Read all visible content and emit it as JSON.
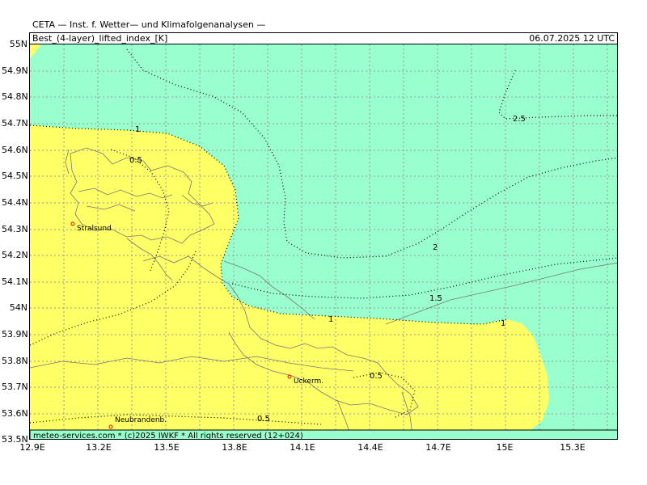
{
  "header": {
    "institute": "CETA — Inst. f. Wetter— und Klimafolgenanalysen —",
    "parameter": "Best_(4-layer)_lifted_index_[K]",
    "valid_time": "06.07.2025  12 UTC"
  },
  "footer": {
    "credit": "meteo-services.com * (c)2025 IWKF * All rights reserved (12+024)"
  },
  "axes": {
    "lat_labels": [
      "55N",
      "54.9N",
      "54.8N",
      "54.7N",
      "54.6N",
      "54.5N",
      "54.4N",
      "54.3N",
      "54.2N",
      "54.1N",
      "54N",
      "53.9N",
      "53.8N",
      "53.7N",
      "53.6N",
      "53.5N"
    ],
    "lon_labels": [
      "12.9E",
      "13.2E",
      "13.5E",
      "13.8E",
      "14.1E",
      "14.4E",
      "14.7E",
      "15E",
      "15.3E"
    ]
  },
  "cities": [
    {
      "name": "Stralsund"
    },
    {
      "name": "Uckerm."
    },
    {
      "name": "Neubrandenb."
    }
  ],
  "contour_labels": [
    "1",
    "0.5",
    "2.5",
    "2",
    "1.5",
    "1",
    "1",
    "0.5",
    "0.5"
  ],
  "colors": {
    "stable_fill": "#99ffcc",
    "unstable_fill": "#ffff66",
    "grid": "#999999",
    "coast": "#666666",
    "city_marker": "#ff0000"
  }
}
